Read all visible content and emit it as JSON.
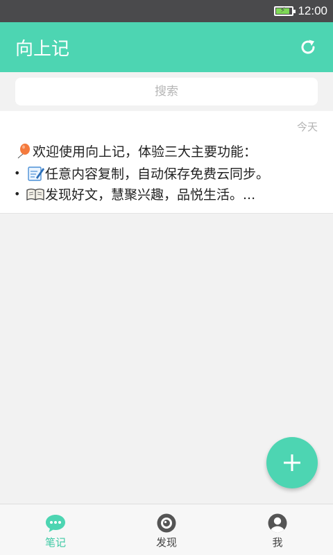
{
  "status_bar": {
    "time": "12:00",
    "battery_icon": "battery-charging-icon"
  },
  "app_bar": {
    "title": "向上记",
    "refresh_icon": "refresh-icon",
    "background_color": "#4dd5b2"
  },
  "search": {
    "placeholder": "搜索",
    "value": ""
  },
  "notes": [
    {
      "date": "今天",
      "lines": [
        {
          "bullet": "",
          "icon": "balloon-icon",
          "text": "欢迎使用向上记，体验三大主要功能："
        },
        {
          "bullet": "•",
          "icon": "memo-icon",
          "text": "任意内容复制，自动保存免费云同步。"
        },
        {
          "bullet": "•",
          "icon": "book-icon",
          "text": "发现好文，慧聚兴趣，品悦生活。..."
        }
      ]
    }
  ],
  "fab": {
    "icon": "plus-icon"
  },
  "bottom_nav": {
    "items": [
      {
        "label": "笔记",
        "icon": "chat-bubble-icon",
        "active": true
      },
      {
        "label": "发现",
        "icon": "discover-icon",
        "active": false
      },
      {
        "label": "我",
        "icon": "person-icon",
        "active": false
      }
    ]
  },
  "colors": {
    "accent": "#4dd5b2",
    "active_label": "#3ec9a4"
  }
}
